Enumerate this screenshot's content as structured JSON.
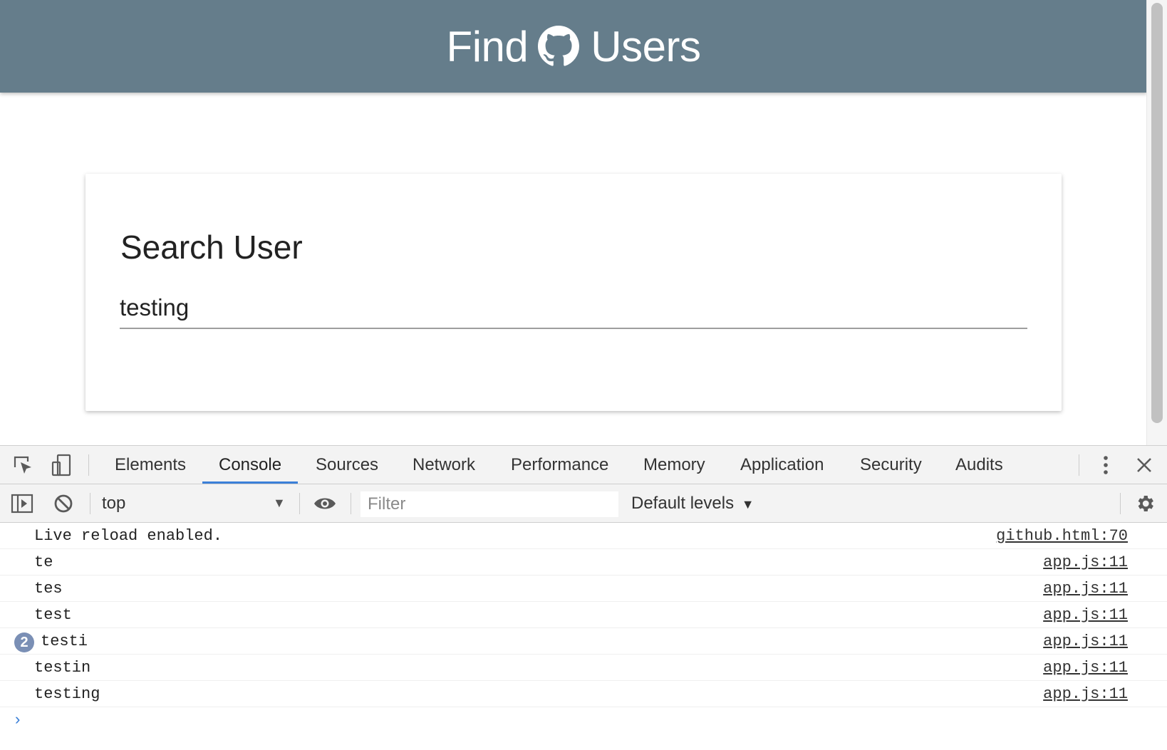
{
  "navbar": {
    "brand_left": "Find",
    "brand_icon": "github-octocat-icon",
    "brand_right": "Users",
    "color": "#657d8b"
  },
  "card": {
    "title": "Search User",
    "search_value": "testing"
  },
  "devtools": {
    "tabs": [
      {
        "label": "Elements",
        "active": false
      },
      {
        "label": "Console",
        "active": true
      },
      {
        "label": "Sources",
        "active": false
      },
      {
        "label": "Network",
        "active": false
      },
      {
        "label": "Performance",
        "active": false
      },
      {
        "label": "Memory",
        "active": false
      },
      {
        "label": "Application",
        "active": false
      },
      {
        "label": "Security",
        "active": false
      },
      {
        "label": "Audits",
        "active": false
      }
    ],
    "toolbar": {
      "context": "top",
      "filter_placeholder": "Filter",
      "levels": "Default levels"
    },
    "console_logs": [
      {
        "message": "Live reload enabled.",
        "source": "github.html:70",
        "count": ""
      },
      {
        "message": "te",
        "source": "app.js:11",
        "count": ""
      },
      {
        "message": "tes",
        "source": "app.js:11",
        "count": ""
      },
      {
        "message": "test",
        "source": "app.js:11",
        "count": ""
      },
      {
        "message": "testi",
        "source": "app.js:11",
        "count": "2"
      },
      {
        "message": "testin",
        "source": "app.js:11",
        "count": ""
      },
      {
        "message": "testing",
        "source": "app.js:11",
        "count": ""
      }
    ],
    "accent": "#3b80d8"
  }
}
